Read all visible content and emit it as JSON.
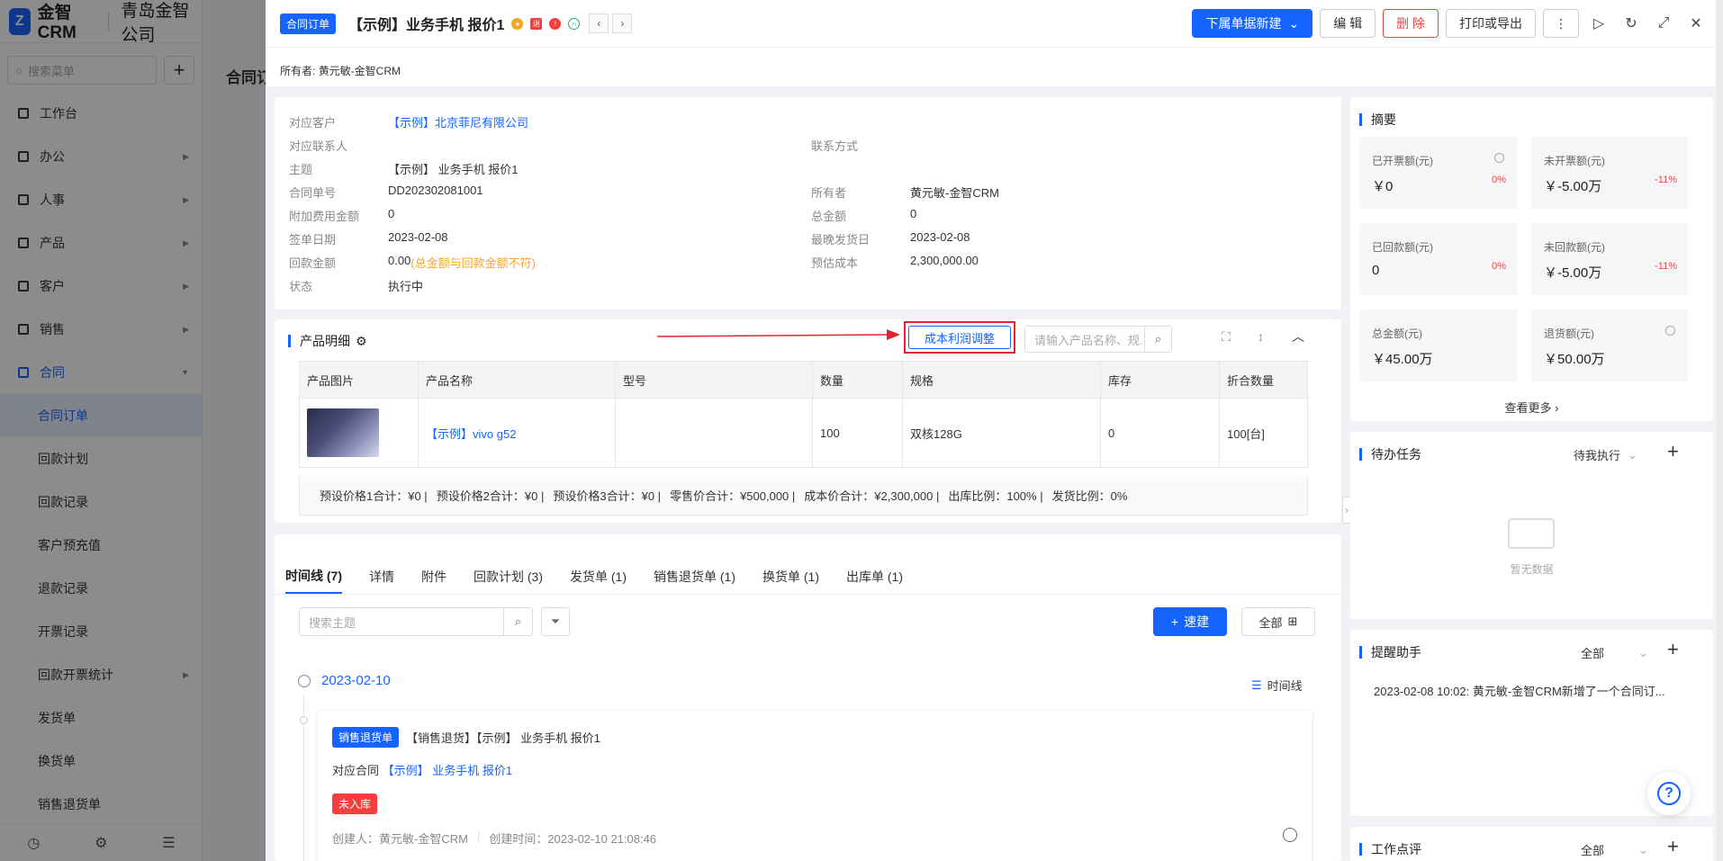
{
  "app": {
    "brand": "金智CRM",
    "company": "青岛金智公司",
    "search_placeholder": "搜索菜单",
    "bg_title": "合同订",
    "menu": [
      {
        "label": "工作台",
        "icon": "workbench-icon"
      },
      {
        "label": "办公",
        "icon": "office-icon"
      },
      {
        "label": "人事",
        "icon": "people-icon"
      },
      {
        "label": "产品",
        "icon": "product-icon"
      },
      {
        "label": "客户",
        "icon": "customer-icon"
      },
      {
        "label": "销售",
        "icon": "sales-icon"
      },
      {
        "label": "合同",
        "icon": "contract-icon"
      }
    ],
    "submenu": [
      {
        "label": "合同订单"
      },
      {
        "label": "回款计划"
      },
      {
        "label": "回款记录"
      },
      {
        "label": "客户预充值"
      },
      {
        "label": "退款记录"
      },
      {
        "label": "开票记录"
      },
      {
        "label": "回款开票统计"
      },
      {
        "label": "发货单"
      },
      {
        "label": "换货单"
      },
      {
        "label": "销售退货单"
      }
    ]
  },
  "header": {
    "tag": "合同订单",
    "title": "【示例】业务手机 报价1",
    "new_child": "下属单据新建",
    "edit": "编 辑",
    "delete": "删 除",
    "print": "打印或导出",
    "more": "⋮",
    "badge_return": "退"
  },
  "owner_line": {
    "label": "所有者:",
    "value": "黄元敏-金智CRM"
  },
  "info": {
    "customer": {
      "label": "对应客户",
      "value": "【示例】北京菲尼有限公司"
    },
    "contact": {
      "label": "对应联系人",
      "value": ""
    },
    "contact_method": {
      "label": "联系方式",
      "value": ""
    },
    "subject": {
      "label": "主题",
      "value": "【示例】 业务手机 报价1"
    },
    "order_no": {
      "label": "合同单号",
      "value": "DD202302081001"
    },
    "owner": {
      "label": "所有者",
      "value": "黄元敏-金智CRM"
    },
    "extra_fee": {
      "label": "附加费用金额",
      "value": "0"
    },
    "total": {
      "label": "总金额",
      "value": "0"
    },
    "sign_date": {
      "label": "签单日期",
      "value": "2023-02-08"
    },
    "latest_ship": {
      "label": "最晚发货日",
      "value": "2023-02-08"
    },
    "paid": {
      "label": "回款金额",
      "value": "0.00",
      "warn": "(总金额与回款金额不符)"
    },
    "est_cost": {
      "label": "预估成本",
      "value": "2,300,000.00"
    },
    "status": {
      "label": "状态",
      "value": "执行中"
    }
  },
  "products": {
    "title": "产品明细",
    "cost_btn": "成本利润调整",
    "search_placeholder": "请输入产品名称、规...",
    "columns": [
      "产品图片",
      "产品名称",
      "型号",
      "数量",
      "规格",
      "库存",
      "折合数量"
    ],
    "rows": [
      {
        "name": "【示例】vivo g52",
        "model": "",
        "qty": "100",
        "spec": "双核128G",
        "stock": "0",
        "conv": "100[台]"
      }
    ],
    "summary": [
      "预设价格1合计：¥0 |",
      "预设价格2合计：¥0 |",
      "预设价格3合计：¥0 |",
      "零售价合计：¥500,000 |",
      "成本价合计：¥2,300,000 |",
      "出库比例：100% |",
      "发货比例：0%"
    ]
  },
  "timeline": {
    "tabs": [
      "时间线 (7)",
      "详情",
      "附件",
      "回款计划 (3)",
      "发货单 (1)",
      "销售退货单 (1)",
      "换货单 (1)",
      "出库单 (1)"
    ],
    "search_placeholder": "搜索主题",
    "quick_create": "速建",
    "all": "全部",
    "date": "2023-02-10",
    "toggle": "时间线",
    "card": {
      "tag": "销售退货单",
      "title": "【销售退货】【示例】 业务手机 报价1",
      "contract_label": "对应合同",
      "contract_value": "【示例】 业务手机 报价1",
      "status": "未入库",
      "creator": "创建人：黄元敏-金智CRM",
      "created": "创建时间：2023-02-10 21:08:46"
    }
  },
  "summary_panel": {
    "title": "摘要",
    "stats": [
      {
        "label": "已开票额(元)",
        "value": "￥0",
        "pct": "0%",
        "clock": true
      },
      {
        "label": "未开票额(元)",
        "value": "￥-5.00万",
        "pct": "-11%",
        "clock": false
      },
      {
        "label": "已回款额(元)",
        "value": "0",
        "pct": "0%",
        "clock": false
      },
      {
        "label": "未回款额(元)",
        "value": "￥-5.00万",
        "pct": "-11%",
        "clock": false
      },
      {
        "label": "总金额(元)",
        "value": "￥45.00万",
        "pct": "",
        "clock": false
      },
      {
        "label": "退货额(元)",
        "value": "￥50.00万",
        "pct": "",
        "clock": true
      }
    ],
    "see_more": "查看更多"
  },
  "todo_panel": {
    "title": "待办任务",
    "filter": "待我执行",
    "empty": "暂无数据"
  },
  "reminder_panel": {
    "title": "提醒助手",
    "filter": "全部",
    "item": "2023-02-08 10:02: 黄元敏-金智CRM新增了一个合同订..."
  },
  "review_panel": {
    "title": "工作点评",
    "filter": "全部"
  },
  "colors": {
    "primary": "#1664ff",
    "danger": "#f53f3f",
    "annotation": "#e4232f"
  }
}
